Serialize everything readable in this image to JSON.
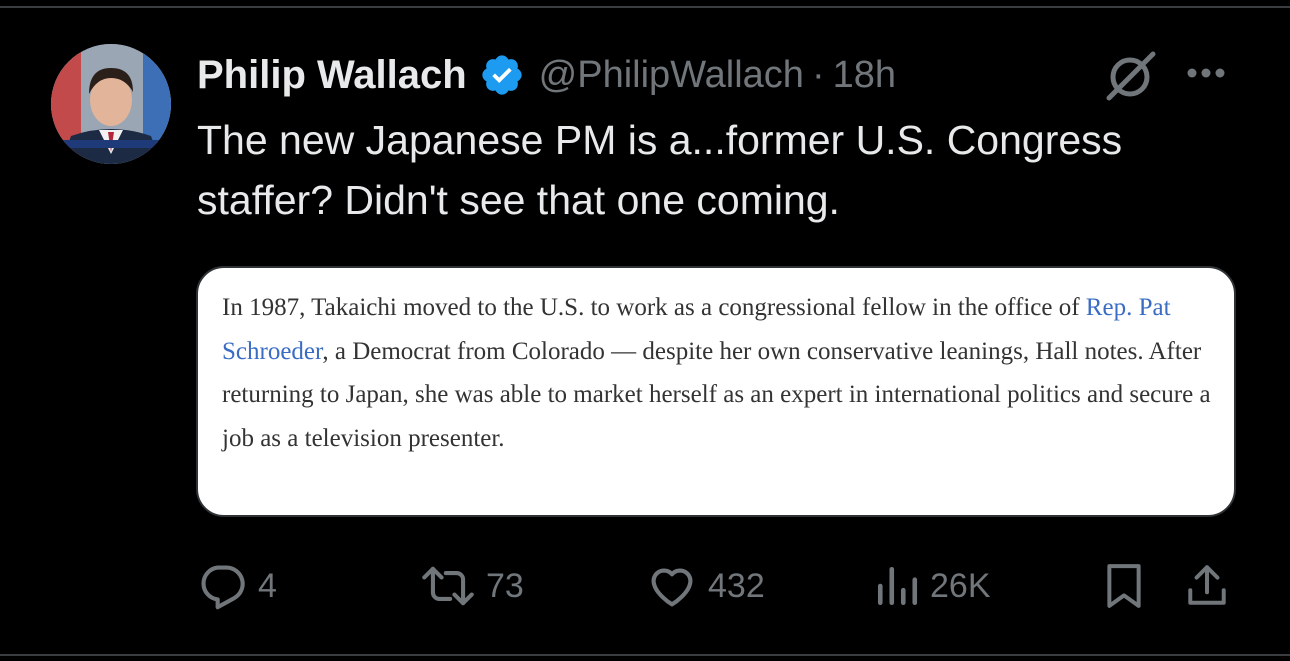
{
  "author": {
    "name": "Philip Wallach",
    "handle": "@PhilipWallach",
    "separator": "·",
    "time": "18h",
    "avatar_alt_icon": "avatar-photo"
  },
  "tweet": {
    "line1": "The new Japanese PM is a...former U.S. Congress",
    "line2": "staffer? Didn't see that one coming."
  },
  "quote": {
    "seg1": "In 1987, Takaichi moved to the U.S. to work as a congressional fellow in the office of ",
    "link": "Rep. Pat Schroeder",
    "seg2": ", a Democrat from Colorado — despite her own conservative leanings, Hall notes. After returning to Japan, she was able to market herself as an expert in international politics and secure a job as a television presenter."
  },
  "actions": {
    "replies": "4",
    "reposts": "73",
    "likes": "432",
    "views": "26K"
  },
  "colors": {
    "background": "#000000",
    "text": "#e7e9ea",
    "muted": "#71767b",
    "verified": "#1d9bf0",
    "link": "#3a6cc4"
  }
}
